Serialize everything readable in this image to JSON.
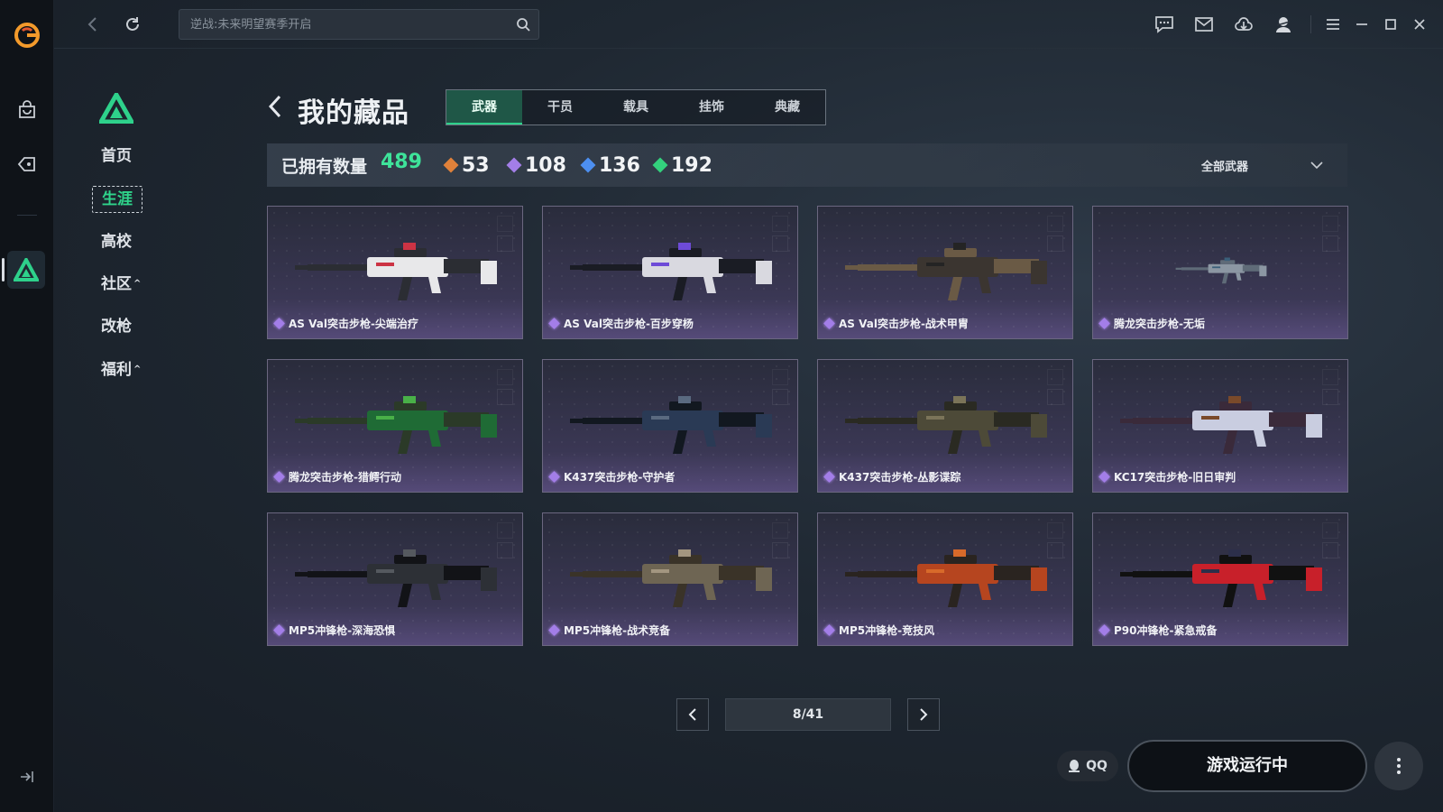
{
  "search": {
    "placeholder": "逆战:未来明望赛季开启"
  },
  "subnav": {
    "items": [
      {
        "label": "首页"
      },
      {
        "label": "生涯"
      },
      {
        "label": "高校"
      },
      {
        "label": "社区"
      },
      {
        "label": "改枪"
      },
      {
        "label": "福利"
      }
    ],
    "caret": "^"
  },
  "header": {
    "title": "我的藏品"
  },
  "tabs": [
    {
      "label": "武器",
      "active": true
    },
    {
      "label": "干员",
      "active": false
    },
    {
      "label": "载具",
      "active": false
    },
    {
      "label": "挂饰",
      "active": false
    },
    {
      "label": "典藏",
      "active": false
    }
  ],
  "stats": {
    "owned_label": "已拥有数量",
    "owned_count": "489",
    "rarities": [
      {
        "value": "53",
        "color": "#e0813a"
      },
      {
        "value": "108",
        "color": "#a37ee8"
      },
      {
        "value": "136",
        "color": "#4d8ff0"
      },
      {
        "value": "192",
        "color": "#33d17d"
      }
    ],
    "filter_label": "全部武器"
  },
  "items": [
    {
      "name": "AS Val突击步枪-尖端治疗"
    },
    {
      "name": "AS Val突击步枪-百步穿杨"
    },
    {
      "name": "AS Val突击步枪-战术甲胄"
    },
    {
      "name": "腾龙突击步枪-无垢"
    },
    {
      "name": "腾龙突击步枪-猎鳄行动"
    },
    {
      "name": "K437突击步枪-守护者"
    },
    {
      "name": "K437突击步枪-丛影谍踪"
    },
    {
      "name": "KC17突击步枪-旧日审判"
    },
    {
      "name": "MP5冲锋枪-深海恐惧"
    },
    {
      "name": "MP5冲锋枪-战术竞备"
    },
    {
      "name": "MP5冲锋枪-竞技风"
    },
    {
      "name": "P90冲锋枪-紧急戒备"
    }
  ],
  "item_rarity_color": "#a37ee8",
  "pager": {
    "label": "8/41"
  },
  "bottom": {
    "qq_label": "QQ",
    "play_label": "游戏运行中"
  },
  "colors": {
    "accent": "#2ed18b",
    "tab_active_bg": "#1f5747"
  }
}
